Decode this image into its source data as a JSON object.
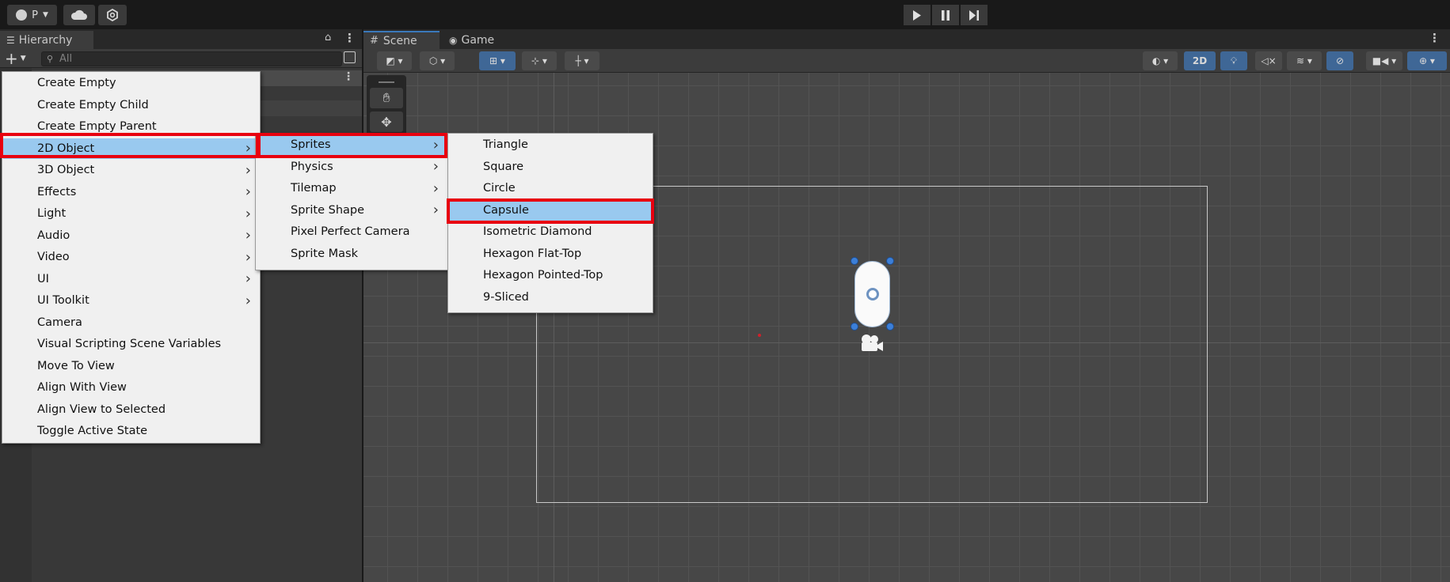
{
  "toolbar": {
    "account_label": "P",
    "icons": [
      "account-icon",
      "cloud-icon",
      "collab-icon",
      "play-icon",
      "pause-icon",
      "step-icon"
    ]
  },
  "hierarchy": {
    "title": "Hierarchy",
    "search_placeholder": "All"
  },
  "scene_tabs": [
    {
      "label": "Scene",
      "icon": "grid-icon"
    },
    {
      "label": "Game",
      "icon": "gamepad-icon"
    }
  ],
  "scene_toolbar": {
    "mode_2d_label": "2D"
  },
  "colors": {
    "highlight": "#99c9ef",
    "annotation_red": "#e8000f",
    "menu_bg": "#f0f0f0",
    "accent_blue": "#3f6796"
  },
  "menus": {
    "main": [
      {
        "label": "Create Empty",
        "submenu": false
      },
      {
        "label": "Create Empty Child",
        "submenu": false
      },
      {
        "label": "Create Empty Parent",
        "submenu": false
      },
      {
        "label": "2D Object",
        "submenu": true,
        "highlighted": true
      },
      {
        "label": "3D Object",
        "submenu": true
      },
      {
        "label": "Effects",
        "submenu": true
      },
      {
        "label": "Light",
        "submenu": true
      },
      {
        "label": "Audio",
        "submenu": true
      },
      {
        "label": "Video",
        "submenu": true
      },
      {
        "label": "UI",
        "submenu": true
      },
      {
        "label": "UI Toolkit",
        "submenu": true
      },
      {
        "label": "Camera",
        "submenu": false
      },
      {
        "label": "Visual Scripting Scene Variables",
        "submenu": false
      },
      {
        "label": "Move To View",
        "submenu": false
      },
      {
        "label": "Align With View",
        "submenu": false
      },
      {
        "label": "Align View to Selected",
        "submenu": false
      },
      {
        "label": "Toggle Active State",
        "submenu": false
      }
    ],
    "object_2d": [
      {
        "label": "Sprites",
        "submenu": true,
        "highlighted": true
      },
      {
        "label": "Physics",
        "submenu": true
      },
      {
        "label": "Tilemap",
        "submenu": true
      },
      {
        "label": "Sprite Shape",
        "submenu": true
      },
      {
        "label": "Pixel Perfect Camera",
        "submenu": false
      },
      {
        "label": "Sprite Mask",
        "submenu": false
      }
    ],
    "sprites": [
      {
        "label": "Triangle"
      },
      {
        "label": "Square"
      },
      {
        "label": "Circle"
      },
      {
        "label": "Capsule",
        "highlighted": true
      },
      {
        "label": "Isometric Diamond"
      },
      {
        "label": "Hexagon Flat-Top"
      },
      {
        "label": "Hexagon Pointed-Top"
      },
      {
        "label": "9-Sliced"
      }
    ]
  }
}
